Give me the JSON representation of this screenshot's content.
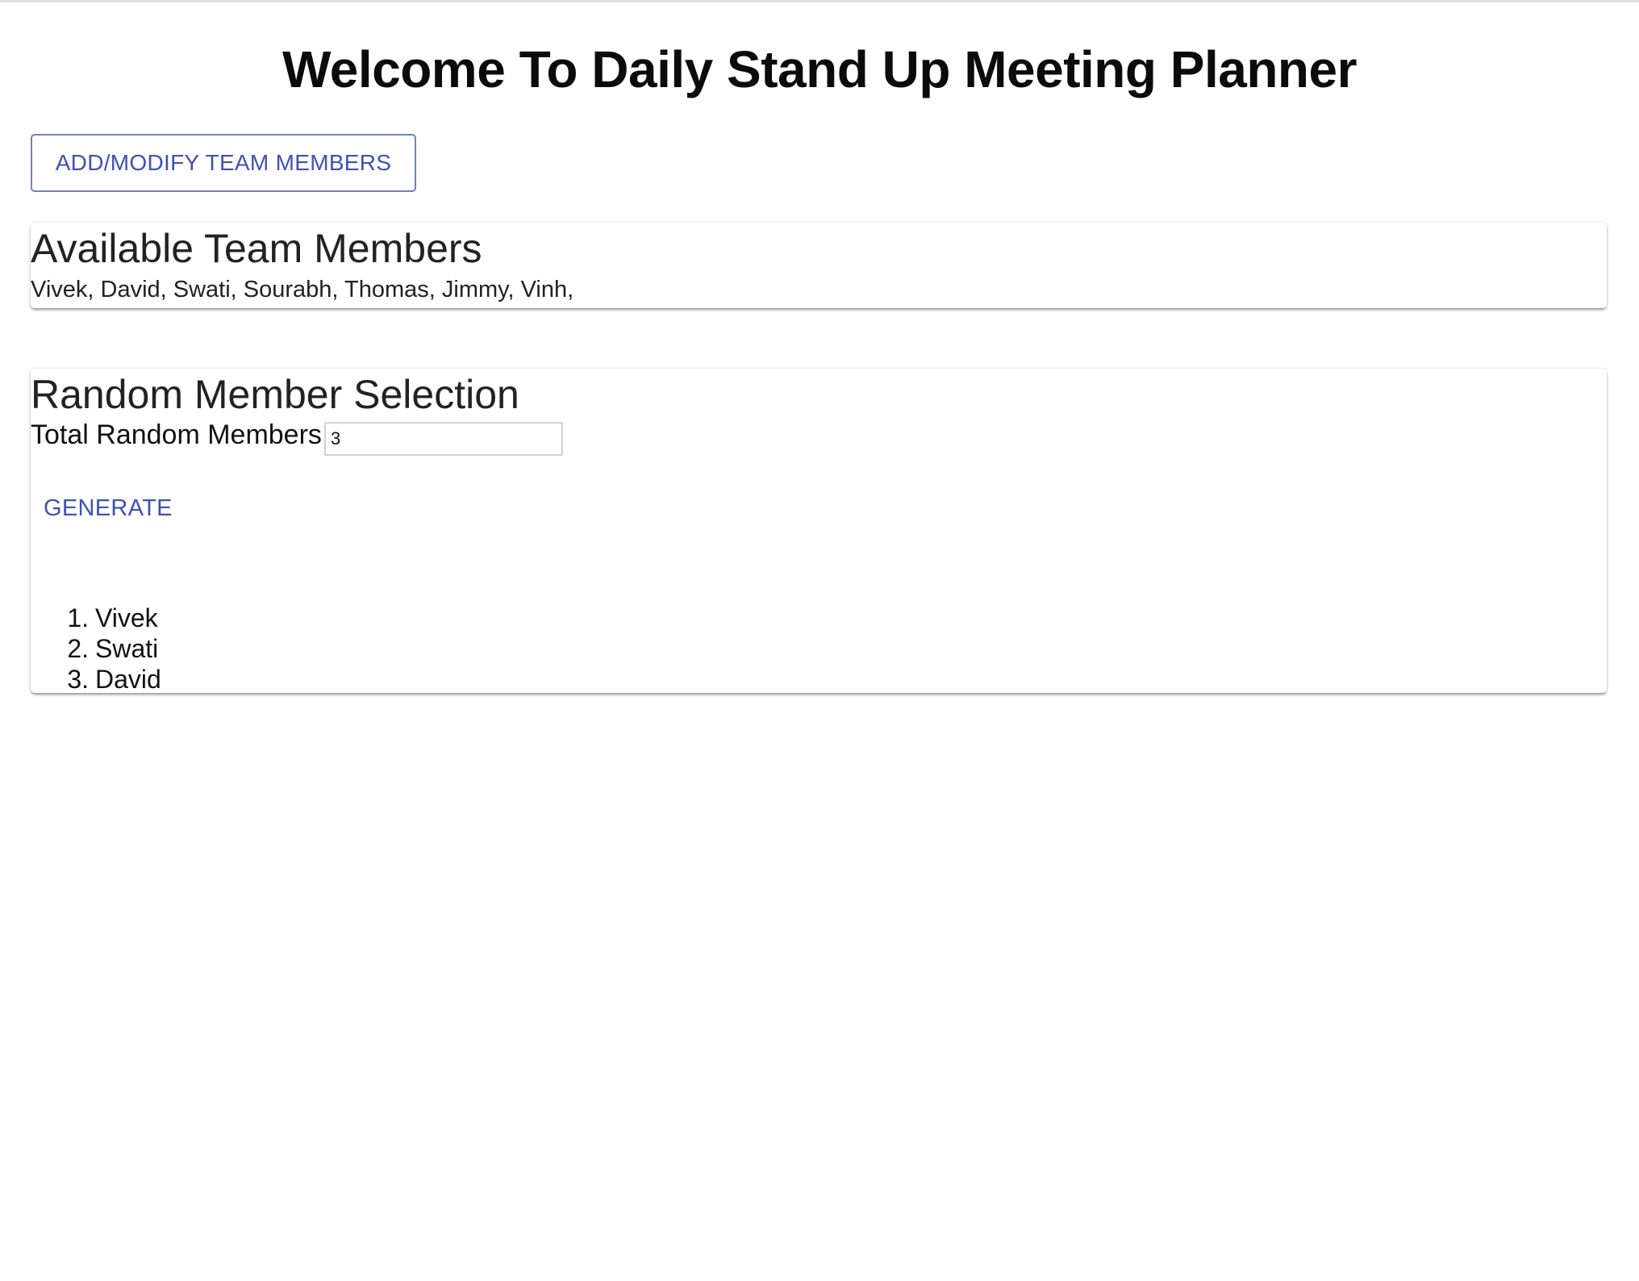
{
  "page": {
    "title": "Welcome To Daily Stand Up Meeting Planner"
  },
  "toolbar": {
    "add_modify_label": "ADD/MODIFY TEAM MEMBERS"
  },
  "available": {
    "heading": "Available Team Members",
    "members_text": "Vivek, David, Swati, Sourabh, Thomas, Jimmy, Vinh,"
  },
  "random": {
    "heading": "Random Member Selection",
    "count_label": "Total Random Members:",
    "count_value": "3",
    "generate_label": "GENERATE",
    "results": [
      {
        "num": "1.",
        "name": "Vivek"
      },
      {
        "num": "2.",
        "name": "Swati"
      },
      {
        "num": "3.",
        "name": "David"
      }
    ]
  },
  "colors": {
    "accent": "#3f51b5",
    "button_border": "#6f7fd0",
    "title": "#0b0b0b",
    "text": "#222222"
  }
}
